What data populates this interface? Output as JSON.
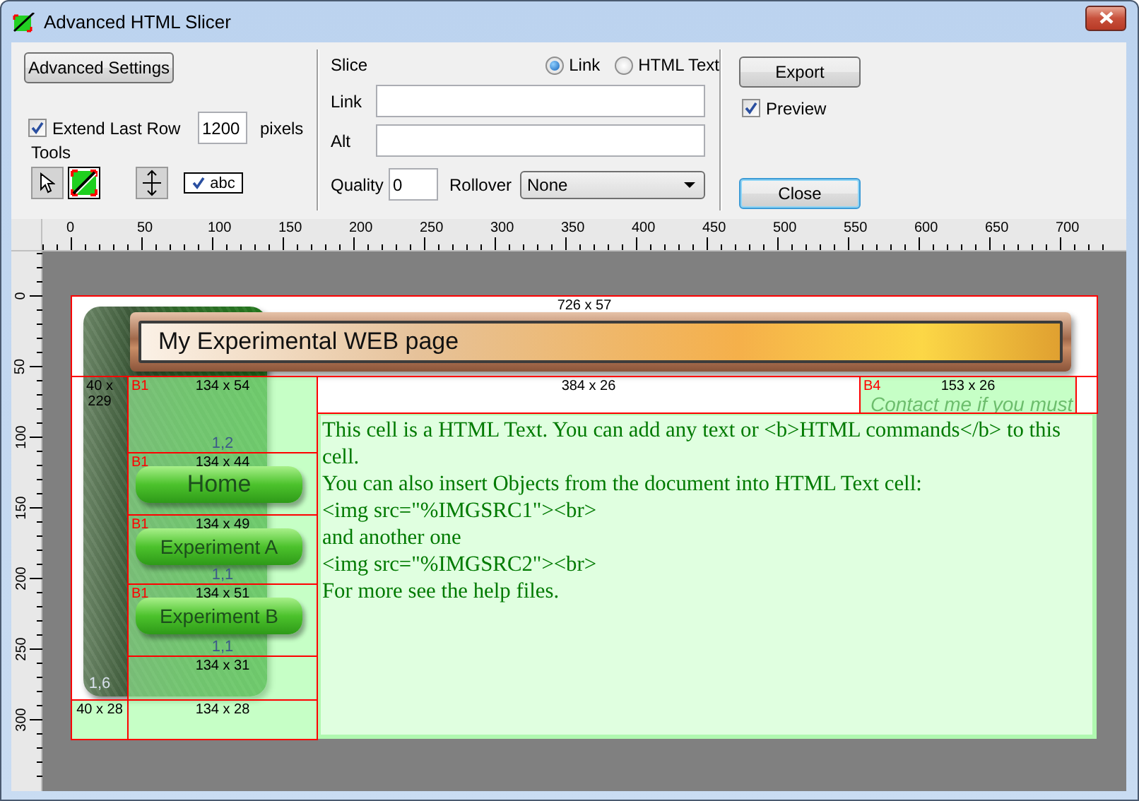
{
  "window": {
    "title": "Advanced HTML Slicer"
  },
  "settings": {
    "advanced_button": "Advanced Settings",
    "extend_last_row": {
      "label": "Extend Last Row",
      "checked": true,
      "value": "1200",
      "unit": "pixels"
    },
    "tools_label": "Tools",
    "tools": [
      {
        "kind": "pointer",
        "selected": false
      },
      {
        "kind": "slice",
        "selected": true
      },
      {
        "kind": "split",
        "selected": false
      }
    ],
    "text_toggle": {
      "label": "abc",
      "checked": true
    }
  },
  "slice": {
    "label": "Slice",
    "types": [
      {
        "label": "Link",
        "selected": true
      },
      {
        "label": "HTML Text",
        "selected": false
      }
    ],
    "link_label": "Link",
    "alt_label": "Alt",
    "quality_label": "Quality",
    "quality_value": "0",
    "rollover_label": "Rollover",
    "rollover_value": "None"
  },
  "actions": {
    "export": "Export",
    "preview": {
      "label": "Preview",
      "checked": true
    },
    "close": "Close"
  },
  "ruler": {
    "x_labels": [
      "0",
      "50",
      "100",
      "150",
      "200",
      "250",
      "300",
      "350",
      "400",
      "450",
      "500",
      "550",
      "600",
      "650",
      "700"
    ],
    "y_labels": [
      "0",
      "50",
      "100",
      "150",
      "200",
      "250",
      "300"
    ]
  },
  "page": {
    "banner": "My Experimental WEB page",
    "nav_buttons": [
      "Home",
      "Experiment A",
      "Experiment B"
    ],
    "contact": "Contact me if you must",
    "html_text": [
      "This cell is a HTML Text. You can add any text or <b>HTML commands</b> to this cell.",
      "You can also insert Objects from the document into HTML Text cell:",
      "<img src=\"%IMGSRC1\"><br>",
      "and another one",
      "<img src=\"%IMGSRC2\"><br>",
      "For more see the help files."
    ]
  },
  "slices": [
    {
      "size": "726 x 57",
      "highlighted": false
    },
    {
      "size": "40 x 229",
      "index": "1,6",
      "highlighted": false
    },
    {
      "size": "134 x 54",
      "tag": "B1",
      "index": "1,2",
      "highlighted": true
    },
    {
      "size": "134 x 44",
      "tag": "B1",
      "highlighted": true
    },
    {
      "size": "134 x 49",
      "tag": "B1",
      "index": "1,1",
      "highlighted": true
    },
    {
      "size": "134 x 51",
      "tag": "B1",
      "index": "1,1",
      "highlighted": true
    },
    {
      "size": "134 x 31",
      "highlighted": true
    },
    {
      "size": "40 x 28",
      "highlighted": true
    },
    {
      "size": "134 x 28",
      "highlighted": true
    },
    {
      "size": "384 x 26",
      "highlighted": false
    },
    {
      "size": "153 x 26",
      "tag": "B4",
      "highlighted": true
    },
    {
      "highlighted": false
    }
  ]
}
